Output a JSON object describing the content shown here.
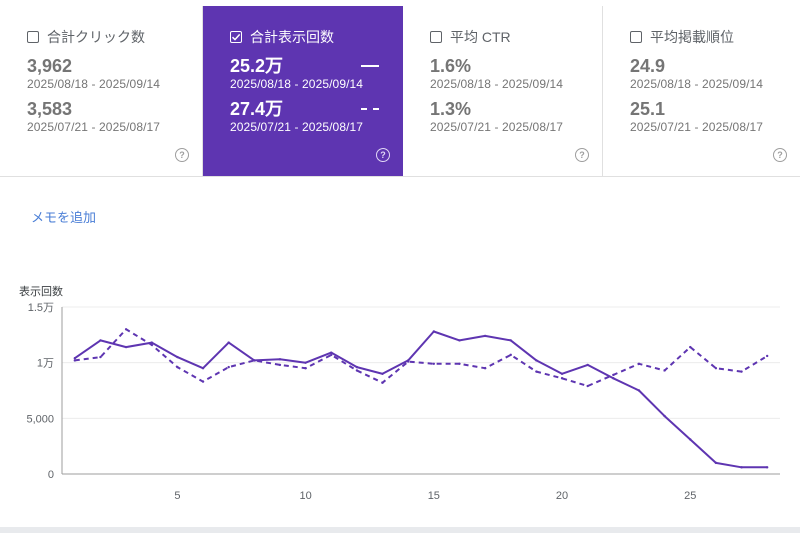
{
  "metrics": [
    {
      "label": "合計クリック数",
      "checked": false,
      "value_current": "3,962",
      "range_current": "2025/08/18 - 2025/09/14",
      "value_previous": "3,583",
      "range_previous": "2025/07/21 - 2025/08/17"
    },
    {
      "label": "合計表示回数",
      "checked": true,
      "value_current": "25.2万",
      "range_current": "2025/08/18 - 2025/09/14",
      "value_previous": "27.4万",
      "range_previous": "2025/07/21 - 2025/08/17"
    },
    {
      "label": "平均 CTR",
      "checked": false,
      "value_current": "1.6%",
      "range_current": "2025/08/18 - 2025/09/14",
      "value_previous": "1.3%",
      "range_previous": "2025/07/21 - 2025/08/17"
    },
    {
      "label": "平均掲載順位",
      "checked": false,
      "value_current": "24.9",
      "range_current": "2025/08/18 - 2025/09/14",
      "value_previous": "25.1",
      "range_previous": "2025/07/21 - 2025/08/17"
    }
  ],
  "help_glyph": "?",
  "memo_link": "メモを追加",
  "colors": {
    "active_card": "#5e35b1",
    "series_line": "#5e35b1",
    "memo_link": "#4a7ed6"
  },
  "chart_data": {
    "type": "line",
    "ylabel": "表示回数",
    "y_ticks": [
      {
        "value": 15000,
        "label": "1.5万"
      },
      {
        "value": 10000,
        "label": "1万"
      },
      {
        "value": 5000,
        "label": "5,000"
      },
      {
        "value": 0,
        "label": "0"
      }
    ],
    "x_ticks": [
      5,
      10,
      15,
      20,
      25
    ],
    "xlim": [
      1,
      28
    ],
    "ylim": [
      0,
      15000
    ],
    "grid": true,
    "series": [
      {
        "style": "solid",
        "x": [
          1,
          2,
          3,
          4,
          5,
          6,
          7,
          8,
          9,
          10,
          11,
          12,
          13,
          14,
          15,
          16,
          17,
          18,
          19,
          20,
          21,
          22,
          23,
          24,
          25,
          26,
          27,
          28
        ],
        "values": [
          10400,
          12000,
          11400,
          11800,
          10500,
          9500,
          11800,
          10200,
          10300,
          10000,
          10900,
          9600,
          9000,
          10200,
          12800,
          12000,
          12400,
          12000,
          10200,
          9000,
          9800,
          8600,
          7500,
          5200,
          3100,
          1000,
          600,
          600
        ]
      },
      {
        "style": "dashed",
        "x": [
          1,
          2,
          3,
          4,
          5,
          6,
          7,
          8,
          9,
          10,
          11,
          12,
          13,
          14,
          15,
          16,
          17,
          18,
          19,
          20,
          21,
          22,
          23,
          24,
          25,
          26,
          27,
          28
        ],
        "values": [
          10200,
          10500,
          13000,
          11600,
          9600,
          8300,
          9600,
          10200,
          9800,
          9500,
          10700,
          9300,
          8200,
          10100,
          9900,
          9900,
          9500,
          10700,
          9200,
          8600,
          7900,
          8900,
          9900,
          9300,
          11400,
          9500,
          9200,
          10600
        ]
      }
    ]
  }
}
